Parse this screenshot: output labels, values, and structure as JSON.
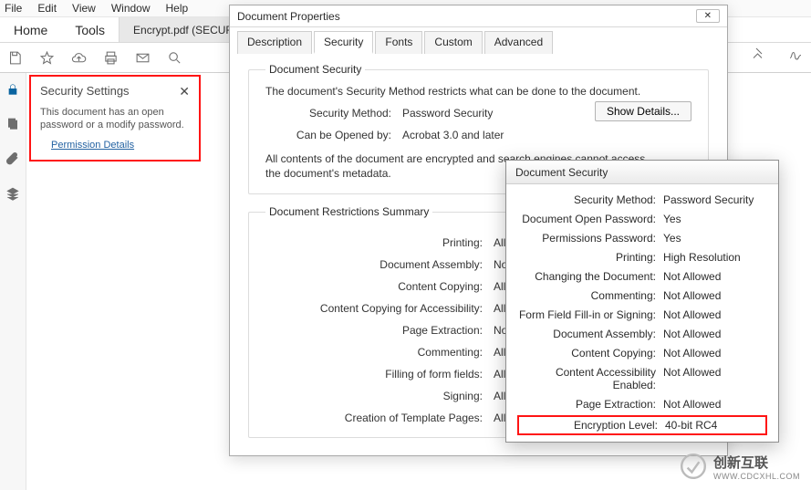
{
  "menubar": [
    "File",
    "Edit",
    "View",
    "Window",
    "Help"
  ],
  "maintabs": {
    "home": "Home",
    "tools": "Tools"
  },
  "doctab": "Encrypt.pdf (SECUR...",
  "sec_panel": {
    "title": "Security Settings",
    "msg": "This document has an open password or a modify password.",
    "link": "Permission Details"
  },
  "dlg": {
    "title": "Document Properties",
    "tabs": [
      "Description",
      "Security",
      "Fonts",
      "Custom",
      "Advanced"
    ],
    "active_tab": 1,
    "fs1_title": "Document Security",
    "desc": "The document's Security Method restricts what can be done to the document.",
    "show_btn": "Show Details...",
    "method_lbl": "Security Method:",
    "method_val": "Password Security",
    "open_lbl": "Can be Opened by:",
    "open_val": "Acrobat 3.0 and later",
    "meta": "All contents of the document are encrypted and search engines cannot access the document's metadata.",
    "fs2_title": "Document Restrictions Summary",
    "restrictions": [
      {
        "lbl": "Printing:",
        "val": "Allowed"
      },
      {
        "lbl": "Document Assembly:",
        "val": "Not Allowed"
      },
      {
        "lbl": "Content Copying:",
        "val": "Allowed"
      },
      {
        "lbl": "Content Copying for Accessibility:",
        "val": "Allowed"
      },
      {
        "lbl": "Page Extraction:",
        "val": "Not Allowed"
      },
      {
        "lbl": "Commenting:",
        "val": "Allowed"
      },
      {
        "lbl": "Filling of form fields:",
        "val": "Allowed"
      },
      {
        "lbl": "Signing:",
        "val": "Allowed"
      },
      {
        "lbl": "Creation of Template Pages:",
        "val": "Allowed"
      }
    ]
  },
  "dsec": {
    "title": "Document Security",
    "rows": [
      {
        "lbl": "Security Method:",
        "val": "Password Security"
      },
      {
        "lbl": "Document Open Password:",
        "val": "Yes"
      },
      {
        "lbl": "Permissions Password:",
        "val": "Yes"
      },
      {
        "lbl": "Printing:",
        "val": "High Resolution"
      },
      {
        "lbl": "Changing the Document:",
        "val": "Not Allowed"
      },
      {
        "lbl": "Commenting:",
        "val": "Not Allowed"
      },
      {
        "lbl": "Form Field Fill-in or Signing:",
        "val": "Not Allowed"
      },
      {
        "lbl": "Document Assembly:",
        "val": "Not Allowed"
      },
      {
        "lbl": "Content Copying:",
        "val": "Not Allowed"
      },
      {
        "lbl": "Content Accessibility Enabled:",
        "val": "Not Allowed"
      },
      {
        "lbl": "Page Extraction:",
        "val": "Not Allowed"
      },
      {
        "lbl": "Encryption Level:",
        "val": "40-bit RC4"
      }
    ]
  },
  "logo": {
    "brand": "创新互联",
    "url": "WWW.CDCXHL.COM"
  }
}
